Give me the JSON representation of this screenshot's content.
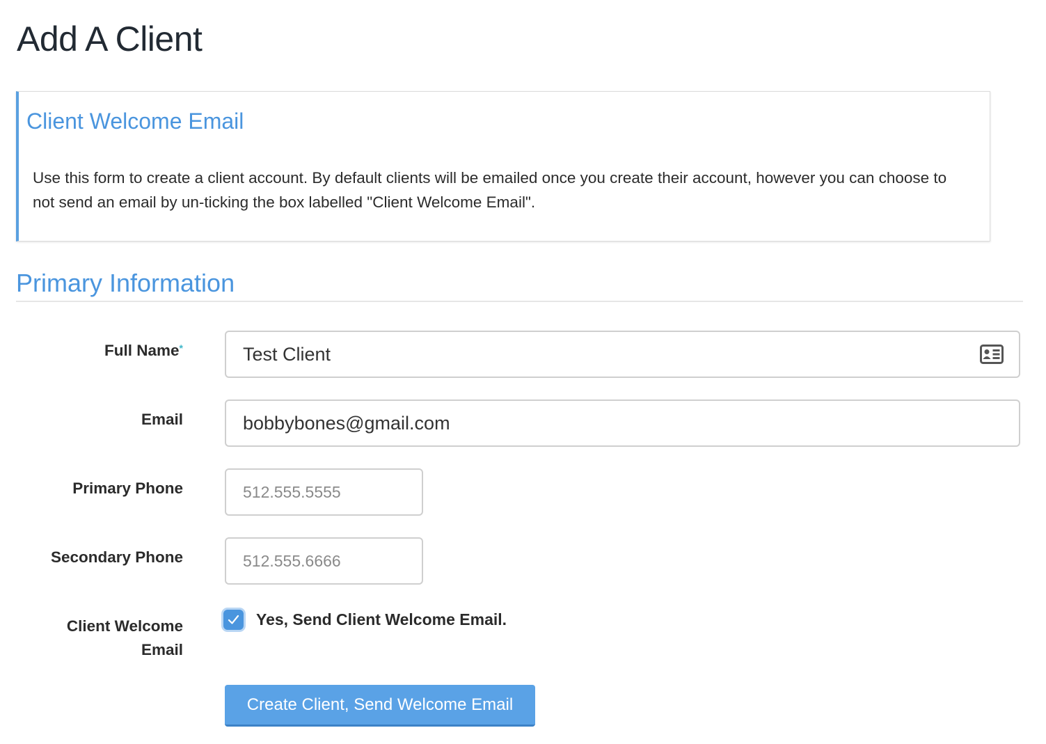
{
  "page": {
    "title": "Add A Client"
  },
  "callout": {
    "title": "Client Welcome Email",
    "body": "Use this form to create a client account. By default clients will be emailed once you create their account, however you can choose to not send an email by un-ticking the box labelled \"Client Welcome Email\"."
  },
  "section": {
    "title": "Primary Information"
  },
  "form": {
    "full_name": {
      "label": "Full Name",
      "required_marker": "*",
      "value": "Test Client",
      "icon": "contact-card-icon"
    },
    "email": {
      "label": "Email",
      "value": "bobbybones@gmail.com"
    },
    "primary_phone": {
      "label": "Primary Phone",
      "placeholder": "512.555.5555"
    },
    "secondary_phone": {
      "label": "Secondary Phone",
      "placeholder": "512.555.6666"
    },
    "welcome_email": {
      "label_line1": "Client Welcome",
      "label_line2": "Email",
      "checkbox_label": "Yes, Send Client Welcome Email.",
      "checked": true
    },
    "submit_label": "Create Client, Send Welcome Email"
  },
  "colors": {
    "accent": "#4a95de",
    "button": "#5aa2e6",
    "required": "#3fb6c9",
    "text": "#2b2b2b"
  }
}
